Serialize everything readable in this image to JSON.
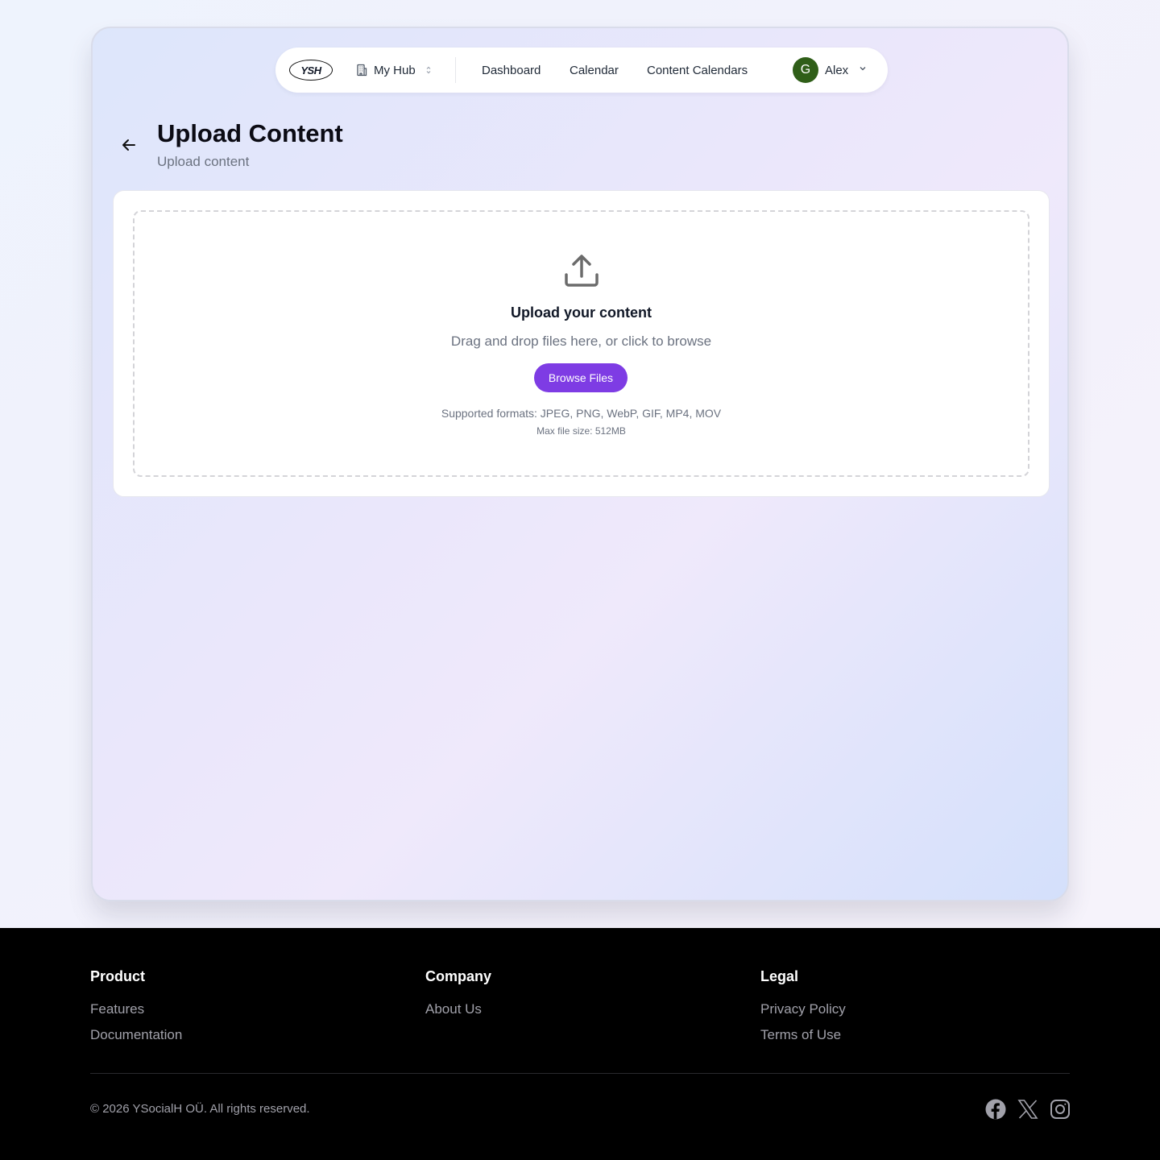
{
  "colors": {
    "accent": "#7e3ce4",
    "avatar_bg": "#2f5e18",
    "footer_bg": "#000000"
  },
  "navbar": {
    "logo_text": "YSH",
    "hub_label": "My Hub",
    "hub_icon": "building-icon",
    "links": [
      "Dashboard",
      "Calendar",
      "Content Calendars"
    ],
    "user_initial": "G",
    "user_name": "Alex"
  },
  "page": {
    "title": "Upload Content",
    "subtitle": "Upload content"
  },
  "upload": {
    "icon": "upload-icon",
    "title": "Upload your content",
    "description": "Drag and drop files here, or click to browse",
    "button_label": "Browse Files",
    "formats": "Supported formats: JPEG, PNG, WebP, GIF, MP4, MOV",
    "max_size": "Max file size: 512MB"
  },
  "footer": {
    "columns": [
      {
        "heading": "Product",
        "links": [
          "Features",
          "Documentation"
        ]
      },
      {
        "heading": "Company",
        "links": [
          "About Us"
        ]
      },
      {
        "heading": "Legal",
        "links": [
          "Privacy Policy",
          "Terms of Use"
        ]
      }
    ],
    "copyright": "© 2026 YSocialH OÜ. All rights reserved.",
    "social": [
      "facebook-icon",
      "x-icon",
      "instagram-icon"
    ]
  }
}
